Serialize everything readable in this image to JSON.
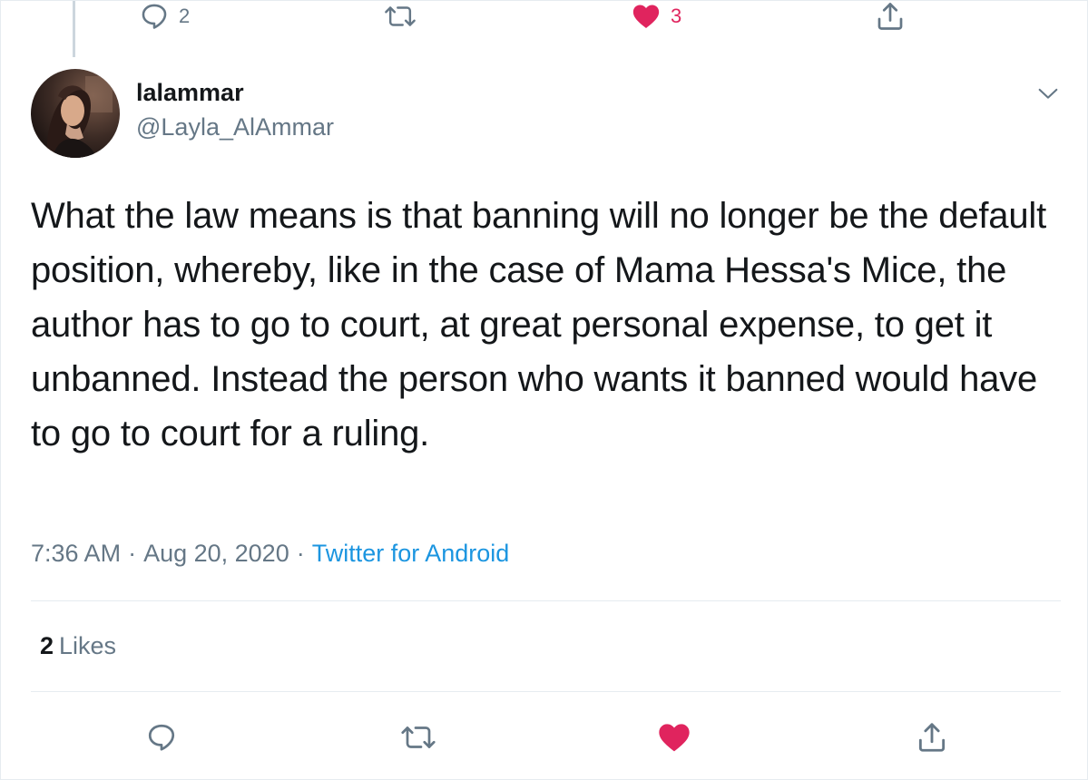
{
  "previous_tweet_actions": {
    "reply_count": "2",
    "retweet_count": "",
    "like_count": "3",
    "icons": [
      "reply-icon",
      "retweet-icon",
      "heart-icon",
      "share-icon"
    ]
  },
  "author": {
    "display_name": "lalammar",
    "handle": "@Layla_AlAmmar"
  },
  "tweet": {
    "text": "What the law means is that banning will no longer be the default position, whereby, like in the case of Mama Hessa's Mice, the author has to go to court, at great personal expense, to get it unbanned. Instead the person who wants it banned would have to go to court for a ruling."
  },
  "meta": {
    "time": "7:36 AM",
    "separator": "·",
    "date": "Aug 20, 2020",
    "source": "Twitter for Android"
  },
  "stats": {
    "likes_count": "2",
    "likes_label": "Likes"
  },
  "bottom_actions": {
    "icons": [
      "reply-icon",
      "retweet-icon",
      "heart-icon",
      "share-icon"
    ]
  },
  "colors": {
    "text_primary": "#14171a",
    "text_secondary": "#657786",
    "link": "#1b95e0",
    "like": "#e0245e",
    "divider": "#e6ecf0"
  }
}
